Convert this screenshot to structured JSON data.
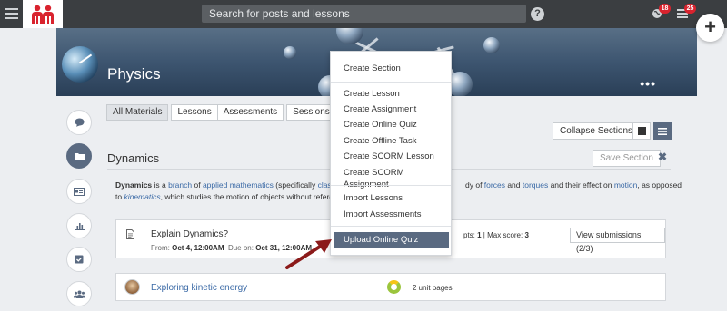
{
  "topbar": {
    "search_placeholder": "Search for posts and lessons",
    "help": "?",
    "notifications_badge": "18",
    "messages_badge": "25",
    "add": "+"
  },
  "banner": {
    "title": "Physics",
    "more": "•••"
  },
  "tabs": [
    "All Materials",
    "Lessons",
    "Assessments",
    "Sessions"
  ],
  "toolbar": {
    "collapse_label": "Collapse Sections"
  },
  "section": {
    "title": "Dynamics",
    "save_label": "Save Section",
    "close": "✖",
    "desc_line1": [
      "Dynamics",
      " is a ",
      "branch",
      " of ",
      "applied mathematics",
      " (specifically ",
      "classica"
    ],
    "desc_line1_right": [
      "dy of ",
      "forces",
      " and ",
      "torques",
      " and their effect on ",
      "motion",
      ", as opposed"
    ],
    "desc_line2": [
      "to ",
      "kinematics",
      ", which studies the motion of objects without referen"
    ]
  },
  "lesson1": {
    "title": "Explain Dynamics?",
    "from_label": "From:",
    "from_value": "Oct 4, 12:00AM",
    "due_label": "Due on:",
    "due_value": "Oct 31, 12:00AM",
    "stats_prefix": "pts: ",
    "stats_attempts": "1",
    "stats_sep": " | Max score: ",
    "stats_max": "3",
    "view_label": "View submissions (2/3)"
  },
  "lesson2": {
    "title": "Exploring kinetic energy",
    "pages": "2 unit pages"
  },
  "dropdown": {
    "items": [
      "Create Section",
      "Create Lesson",
      "Create Assignment",
      "Create Online Quiz",
      "Create Offline Task",
      "Create SCORM Lesson",
      "Create SCORM Assignment",
      "Import Lessons",
      "Import Assessments",
      "Upload Online Quiz"
    ]
  },
  "colors": {
    "topbar": "#3b3e41",
    "accent": "#5a6a81",
    "link": "#3b6aa6",
    "badge": "#d9232e",
    "arrow": "#8b1a1a"
  }
}
